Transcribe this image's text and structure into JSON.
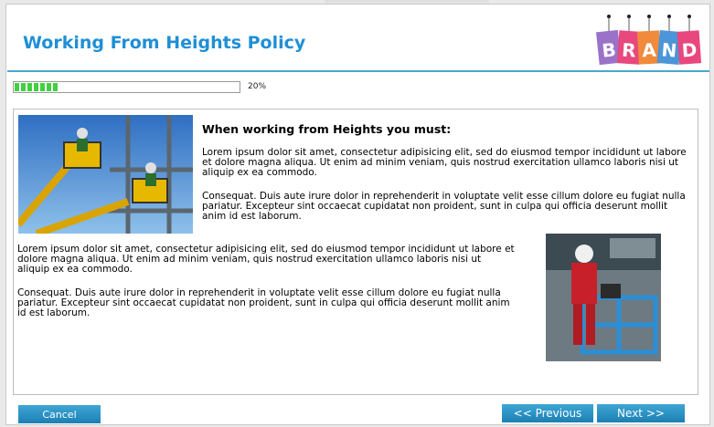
{
  "header": {
    "title": "Working From Heights Policy",
    "brand_logo": "BRAND",
    "brand_colors": [
      "#9a73c9",
      "#e8487e",
      "#f18a3a",
      "#4c95d8",
      "#e8487e"
    ]
  },
  "progress": {
    "value": 0.2,
    "label": "20%"
  },
  "content": {
    "heading": "When working from Heights you must:",
    "paragraph_1": "Lorem ipsum dolor sit amet, consectetur adipisicing elit, sed do eiusmod tempor incididunt ut labore et dolore magna aliqua. Ut enim ad minim veniam, quis nostrud exercitation ullamco laboris nisi ut aliquip ex ea commodo.",
    "paragraph_2": "Consequat. Duis aute irure dolor in reprehenderit in voluptate velit esse cillum dolore eu fugiat nulla pariatur. Excepteur sint occaecat cupidatat non proident, sunt in culpa qui officia deserunt mollit anim id est laborum.",
    "paragraph_3": "Lorem ipsum dolor sit amet, consectetur adipisicing elit, sed do eiusmod tempor incididunt ut labore et dolore magna aliqua. Ut enim ad minim veniam, quis nostrud exercitation ullamco laboris nisi ut aliquip ex ea commodo.",
    "paragraph_4": "Consequat. Duis aute irure dolor in reprehenderit in voluptate velit esse cillum dolore eu fugiat nulla pariatur. Excepteur sint occaecat cupidatat non proident, sunt in culpa qui officia deserunt mollit anim id est laborum.",
    "image_1": "aerial-work-platform-photo",
    "image_2": "worker-on-lift-photo"
  },
  "footer": {
    "cancel_label": "Cancel",
    "previous_label": "<< Previous",
    "next_label": "Next >>"
  },
  "colors": {
    "title": "#1f8fd6",
    "accent_line": "#4aa7cf",
    "button": "#2690c5",
    "progress": "#3fd13f"
  }
}
